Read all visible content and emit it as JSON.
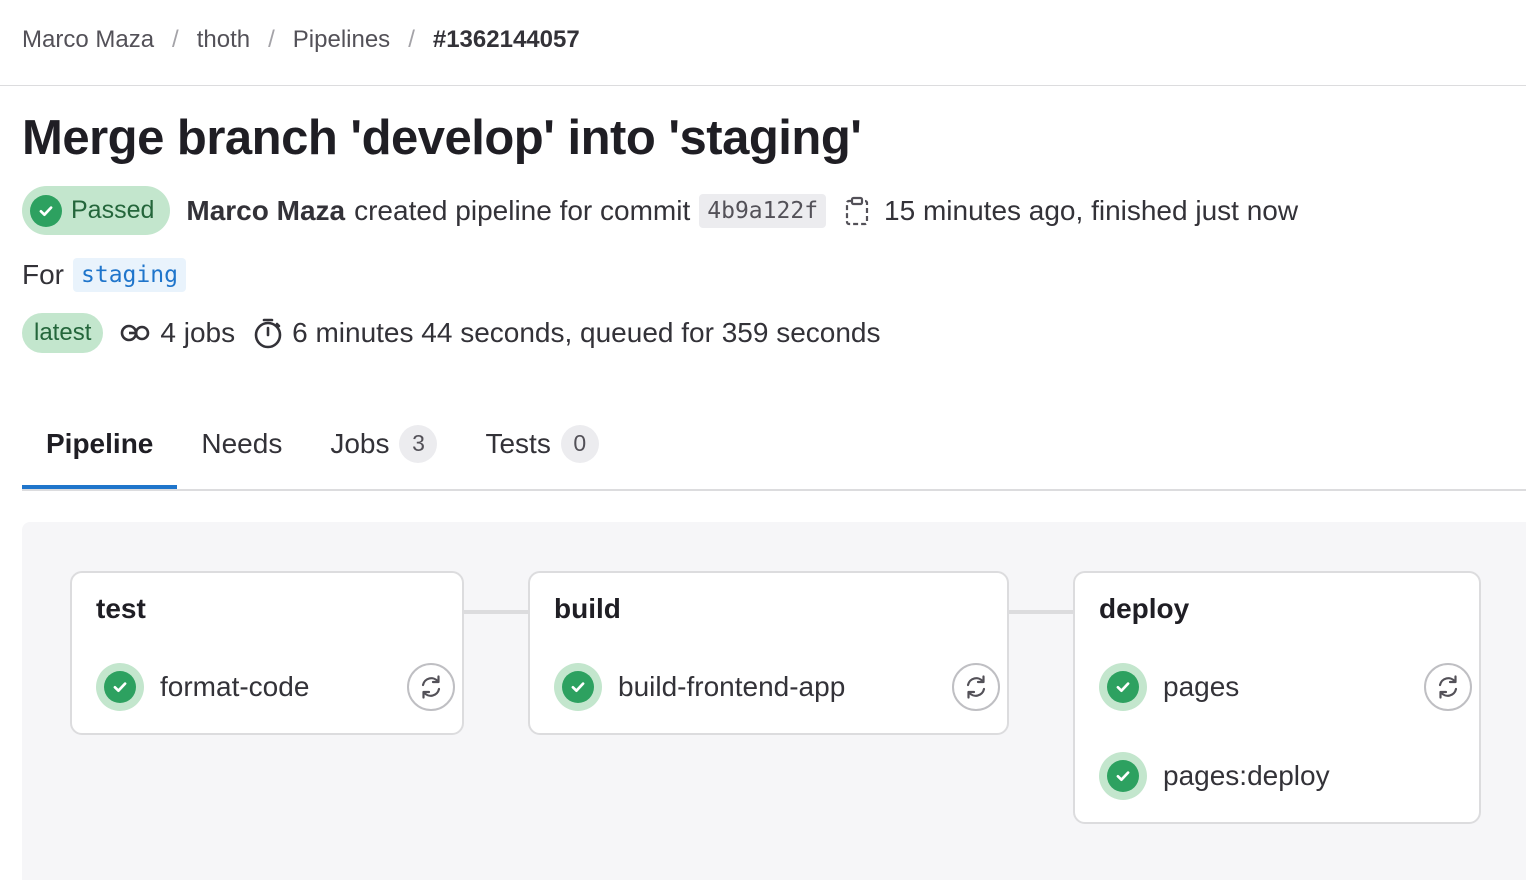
{
  "breadcrumb": {
    "items": [
      "Marco Maza",
      "thoth",
      "Pipelines"
    ],
    "current": "#1362144057",
    "separator": "/"
  },
  "title": "Merge branch 'develop' into 'staging'",
  "status": {
    "badge": "Passed",
    "author": "Marco Maza",
    "action": "created pipeline for commit",
    "commit_sha": "4b9a122f",
    "time": "15 minutes ago, finished just now"
  },
  "ref": {
    "prefix": "For",
    "branch": "staging"
  },
  "meta": {
    "latest_badge": "latest",
    "jobs": "4 jobs",
    "duration": "6 minutes 44 seconds, queued for 359 seconds"
  },
  "tabs": [
    {
      "label": "Pipeline",
      "active": true
    },
    {
      "label": "Needs"
    },
    {
      "label": "Jobs",
      "count": "3"
    },
    {
      "label": "Tests",
      "count": "0"
    }
  ],
  "stages": [
    {
      "name": "test",
      "jobs": [
        {
          "name": "format-code",
          "status": "passed",
          "retry": true
        }
      ]
    },
    {
      "name": "build",
      "jobs": [
        {
          "name": "build-frontend-app",
          "status": "passed",
          "retry": true
        }
      ]
    },
    {
      "name": "deploy",
      "jobs": [
        {
          "name": "pages",
          "status": "passed",
          "retry": true
        },
        {
          "name": "pages:deploy",
          "status": "passed",
          "retry": false
        }
      ]
    }
  ],
  "colors": {
    "success": "#2da160",
    "success_bg": "#c3e6cd",
    "link": "#1f75cb",
    "tab_underline": "#1f75cb"
  },
  "icons": {
    "status": "check-circle-icon",
    "copy": "clipboard-icon",
    "jobs": "pipeline-icon",
    "duration": "timer-icon",
    "retry": "retry-icon"
  }
}
